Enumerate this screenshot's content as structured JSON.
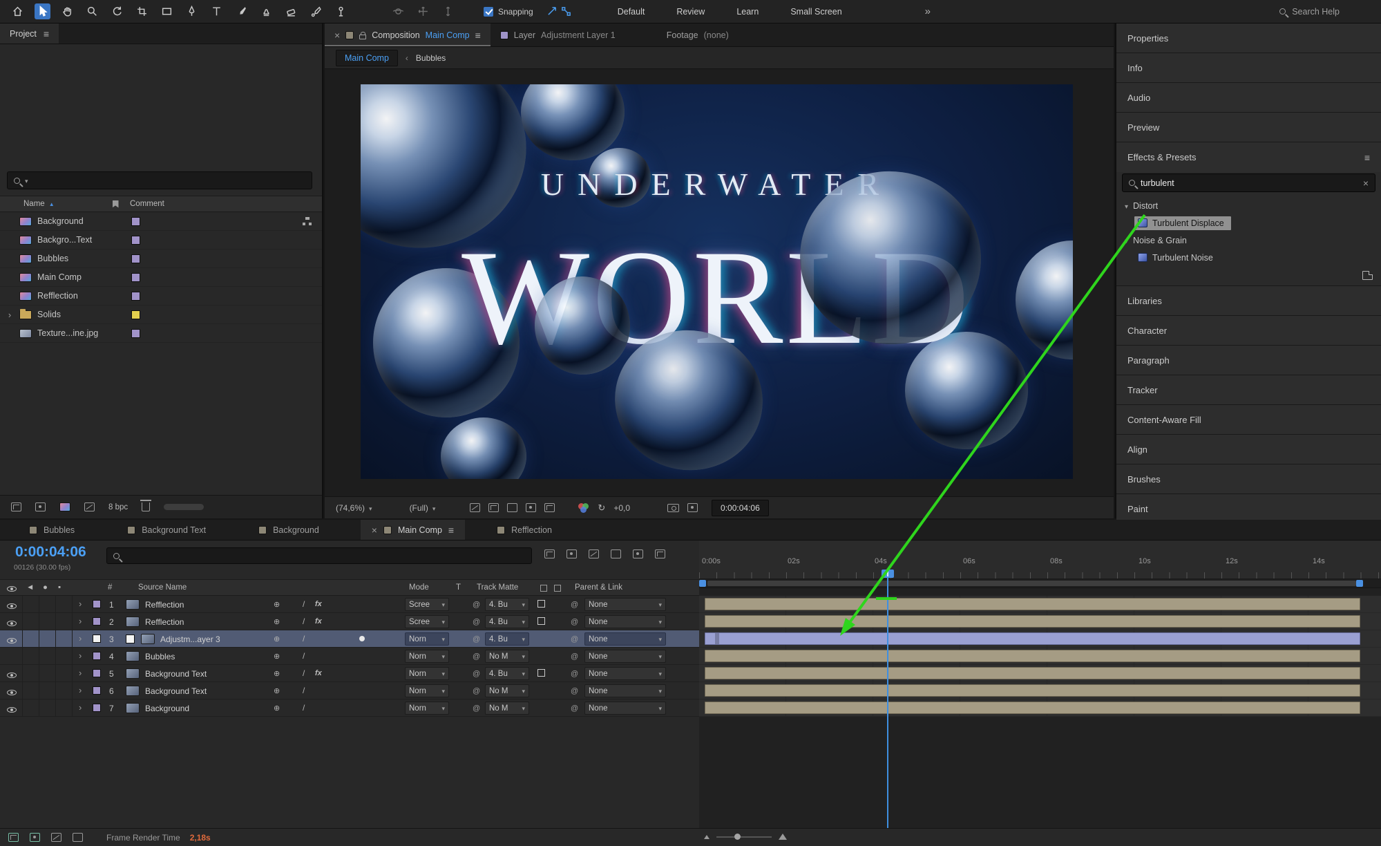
{
  "toolbar": {
    "snapping_label": "Snapping",
    "workspaces": [
      "Default",
      "Review",
      "Learn",
      "Small Screen"
    ],
    "overflow": "»",
    "search_placeholder": "Search Help"
  },
  "icons": {
    "search": "magnifier-css-shape",
    "menu": "≡",
    "close": "×",
    "caret": "▾",
    "chevron": "›",
    "link": "@",
    "refresh": "↻",
    "sort": "▲"
  },
  "project": {
    "tab": "Project",
    "columns": {
      "name": "Name",
      "comment": "Comment"
    },
    "items": [
      {
        "name": "Background"
      },
      {
        "name": "Backgro...Text"
      },
      {
        "name": "Bubbles"
      },
      {
        "name": "Main Comp"
      },
      {
        "name": "Refflection"
      },
      {
        "name": "Solids"
      },
      {
        "name": "Texture...ine.jpg"
      }
    ],
    "bit_depth": "8 bpc"
  },
  "comp": {
    "tabs": [
      {
        "label": "Composition",
        "target": "Main Comp"
      },
      {
        "label": "Layer",
        "target": "Adjustment Layer 1"
      },
      {
        "label": "Footage",
        "target": "(none)"
      }
    ],
    "breadcrumb": {
      "current": "Main Comp",
      "separator": "‹",
      "child": "Bubbles"
    },
    "artwork": {
      "title_small": "UNDERWATER",
      "title_large": "WORLD"
    },
    "footer": {
      "zoom": "(74,6%)",
      "resolution": "(Full)",
      "exposure": "+0,0",
      "timecode": "0:00:04:06"
    }
  },
  "right_panels": {
    "top": [
      "Properties",
      "Info",
      "Audio",
      "Preview"
    ],
    "effects": {
      "title": "Effects & Presets",
      "search_value": "turbulent",
      "group1": "Distort",
      "item1": "Turbulent Displace",
      "group2": "Noise & Grain",
      "item2": "Turbulent Noise"
    },
    "bottom": [
      "Libraries",
      "Character",
      "Paragraph",
      "Tracker",
      "Content-Aware Fill",
      "Align",
      "Brushes",
      "Paint"
    ]
  },
  "timeline": {
    "tabs": [
      {
        "label": "Bubbles"
      },
      {
        "label": "Background Text"
      },
      {
        "label": "Background"
      },
      {
        "label": "Main Comp"
      },
      {
        "label": "Refflection"
      }
    ],
    "timecode": "0:00:04:06",
    "frames": "00126 (30.00 fps)",
    "columns": {
      "index": "#",
      "source": "Source Name",
      "mode": "Mode",
      "t": "T",
      "matte": "Track Matte",
      "parent": "Parent & Link"
    },
    "layers": [
      {
        "num": "1",
        "name": "Refflection",
        "mode": "Scree",
        "matte": "4. Bu",
        "parent": "None"
      },
      {
        "num": "2",
        "name": "Refflection",
        "mode": "Scree",
        "matte": "4. Bu",
        "parent": "None"
      },
      {
        "num": "3",
        "name": "Adjustm...ayer 3",
        "mode": "Norn",
        "matte": "4. Bu",
        "parent": "None"
      },
      {
        "num": "4",
        "name": "Bubbles",
        "mode": "Norn",
        "matte": "No M",
        "parent": "None"
      },
      {
        "num": "5",
        "name": "Background Text",
        "mode": "Norn",
        "matte": "4. Bu",
        "parent": "None"
      },
      {
        "num": "6",
        "name": "Background Text",
        "mode": "Norn",
        "matte": "No M",
        "parent": "None"
      },
      {
        "num": "7",
        "name": "Background",
        "mode": "Norn",
        "matte": "No M",
        "parent": "None"
      }
    ],
    "ruler": [
      "0:00s",
      "02s",
      "04s",
      "06s",
      "08s",
      "10s",
      "12s",
      "14s"
    ],
    "status": {
      "label": "Frame Render Time",
      "value": "2,18s"
    }
  },
  "colors": {
    "accent_blue": "#4ba0f5",
    "annotation_green": "#2fd51d",
    "layer_bar_tan": "#a59c84",
    "layer_bar_selected": "#9aa0d2",
    "render_time_orange": "#e06a3c"
  }
}
